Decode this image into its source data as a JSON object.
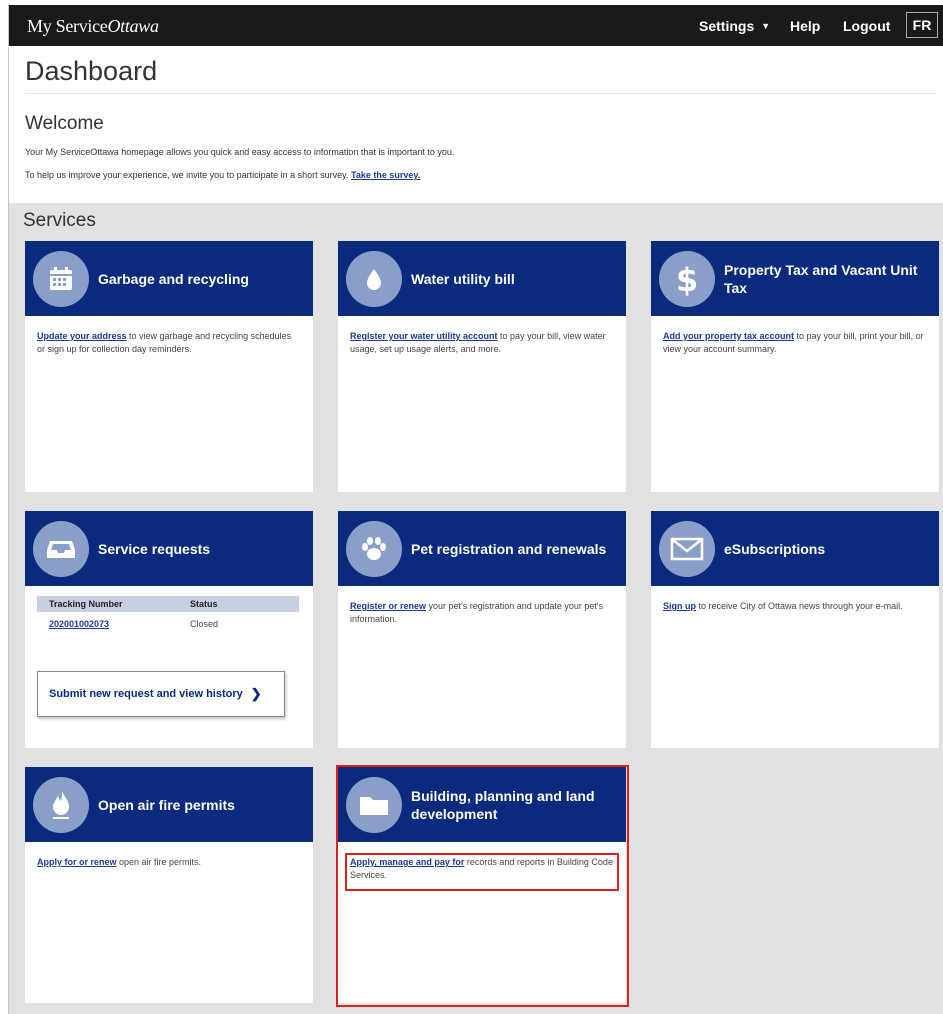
{
  "header": {
    "logo_prefix": "My Service",
    "logo_suffix": "Ottawa",
    "nav": {
      "settings": "Settings",
      "help": "Help",
      "logout": "Logout",
      "language": "FR"
    }
  },
  "page": {
    "title": "Dashboard",
    "welcome_title": "Welcome",
    "welcome_text": "Your My ServiceOttawa homepage allows you quick and easy access to information that is important to you.",
    "survey_text": "To help us improve your experience, we invite you to participate in a short survey.",
    "survey_link": "Take the survey."
  },
  "services": {
    "title": "Services",
    "cards": [
      {
        "title": "Garbage and recycling",
        "icon": "calendar-icon",
        "link": "Update your address",
        "text": " to view garbage and recycling schedules or sign up for collection day reminders."
      },
      {
        "title": "Water utility bill",
        "icon": "water-drop-icon",
        "link": "Register your water utility account",
        "text": " to pay your bill, view water usage, set up usage alerts, and more."
      },
      {
        "title": "Property Tax and Vacant Unit Tax",
        "icon": "dollar-icon",
        "link": "Add your property tax account",
        "text": " to pay your bill, print your bill, or view your account summary."
      },
      {
        "title": "Service requests",
        "icon": "inbox-icon",
        "table_headers": [
          "Tracking Number",
          "Status"
        ],
        "rows": [
          {
            "tracking": "202001002073",
            "status": "Closed"
          }
        ],
        "button": "Submit new request and view history"
      },
      {
        "title": "Pet registration and renewals",
        "icon": "paw-icon",
        "link": "Register or renew",
        "text": " your pet's registration and update your pet's information."
      },
      {
        "title": "eSubscriptions",
        "icon": "envelope-icon",
        "link": "Sign up",
        "text": " to receive City of Ottawa news through your e-mail."
      },
      {
        "title": "Open air fire permits",
        "icon": "flame-icon",
        "link": "Apply for or renew",
        "text": " open air fire permits."
      },
      {
        "title": "Building, planning and land development",
        "icon": "folder-icon",
        "link": "Apply, manage and pay for",
        "text": " records and reports in Building Code Services."
      }
    ]
  },
  "colors": {
    "topbar": "#1a1a1a",
    "card_header": "#0a2a7e",
    "icon_circle": "#8a9fc8",
    "services_bg": "#e1e1e1",
    "link": "#1a3a9a",
    "highlight": "#d9221e"
  }
}
